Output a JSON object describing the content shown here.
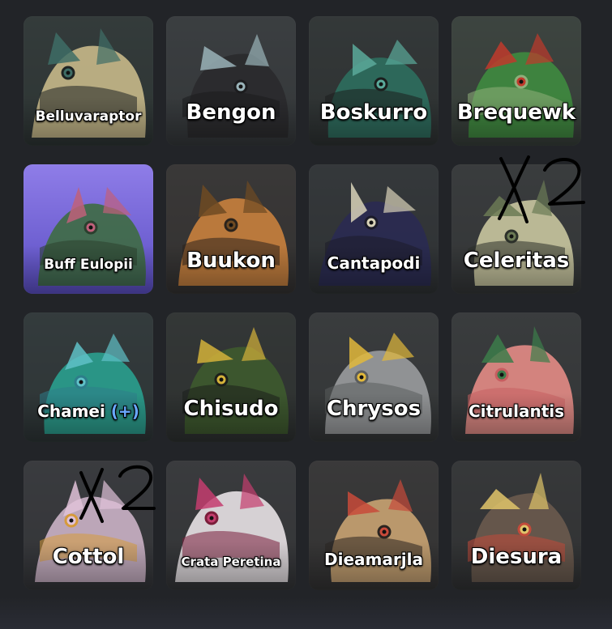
{
  "creatures": [
    {
      "name": "Belluvaraptor",
      "size": "s",
      "palette": [
        "#2f3a36",
        "#c8b98a",
        "#3e6d66",
        "#1e2322"
      ]
    },
    {
      "name": "Bengon",
      "size": "l",
      "palette": [
        "#3c3f42",
        "#2a2a2c",
        "#9ab3b9",
        "#1c1c1e"
      ]
    },
    {
      "name": "Boskurro",
      "size": "l",
      "palette": [
        "#2f3533",
        "#2d6e5e",
        "#5aa99a",
        "#1b1e1d"
      ]
    },
    {
      "name": "Brequewk",
      "size": "l",
      "palette": [
        "#3f4a3f",
        "#3f8b3f",
        "#c0392b",
        "#8fae7a"
      ]
    },
    {
      "name": "Buff Eulopii",
      "size": "s",
      "palette": [
        "#7d6fd9",
        "#3e6b43",
        "#c0607a",
        "#2b3f2e"
      ]
    },
    {
      "name": "Buukon",
      "size": "l",
      "palette": [
        "#3b3532",
        "#c9813d",
        "#6f4a22",
        "#2b231c"
      ]
    },
    {
      "name": "Cantapodi",
      "size": "m",
      "palette": [
        "#323537",
        "#2a2a52",
        "#d8d2b8",
        "#1b1b2a"
      ]
    },
    {
      "name": "Celeritas",
      "size": "l",
      "palette": [
        "#3a3d3c",
        "#c9c7a0",
        "#6b7a55",
        "#2c302a"
      ]
    },
    {
      "name": "Chamei",
      "plus": "(+)",
      "size": "m",
      "palette": [
        "#2f3a3a",
        "#2aa08f",
        "#5fc1c7",
        "#2d7d8a"
      ]
    },
    {
      "name": "Chisudo",
      "size": "l",
      "palette": [
        "#2f3330",
        "#3e5a2d",
        "#d4b23a",
        "#1c1f1b"
      ]
    },
    {
      "name": "Chrysos",
      "size": "l",
      "palette": [
        "#3a3c3d",
        "#9a9c9e",
        "#e2b93b",
        "#5a5c5d"
      ]
    },
    {
      "name": "Citrulantis",
      "size": "m",
      "palette": [
        "#3a3c3c",
        "#e48c86",
        "#3c7d4a",
        "#c75e60"
      ]
    },
    {
      "name": "Cottol",
      "size": "l",
      "palette": [
        "#3a3a3e",
        "#cbb2c6",
        "#e0c2d8",
        "#d69a3a"
      ]
    },
    {
      "name": "Crata Peretina",
      "size": "xs",
      "palette": [
        "#3a3a3c",
        "#e8e2e6",
        "#c43d6e",
        "#7a1e3a"
      ]
    },
    {
      "name": "Dieamarjla",
      "size": "m",
      "palette": [
        "#3a3635",
        "#c9a372",
        "#c84a3a",
        "#2a2420"
      ]
    },
    {
      "name": "Diesura",
      "size": "l",
      "palette": [
        "#343434",
        "#6a5a4e",
        "#e0c46a",
        "#c24a3a"
      ]
    }
  ],
  "selected_index": 4,
  "annotations": [
    "X2",
    "X2"
  ],
  "colors": {
    "background": "#222428",
    "card": "#35383b",
    "selected_card": "#7d6fd9",
    "label": "#ffffff",
    "plus": "#6aa8ff"
  }
}
